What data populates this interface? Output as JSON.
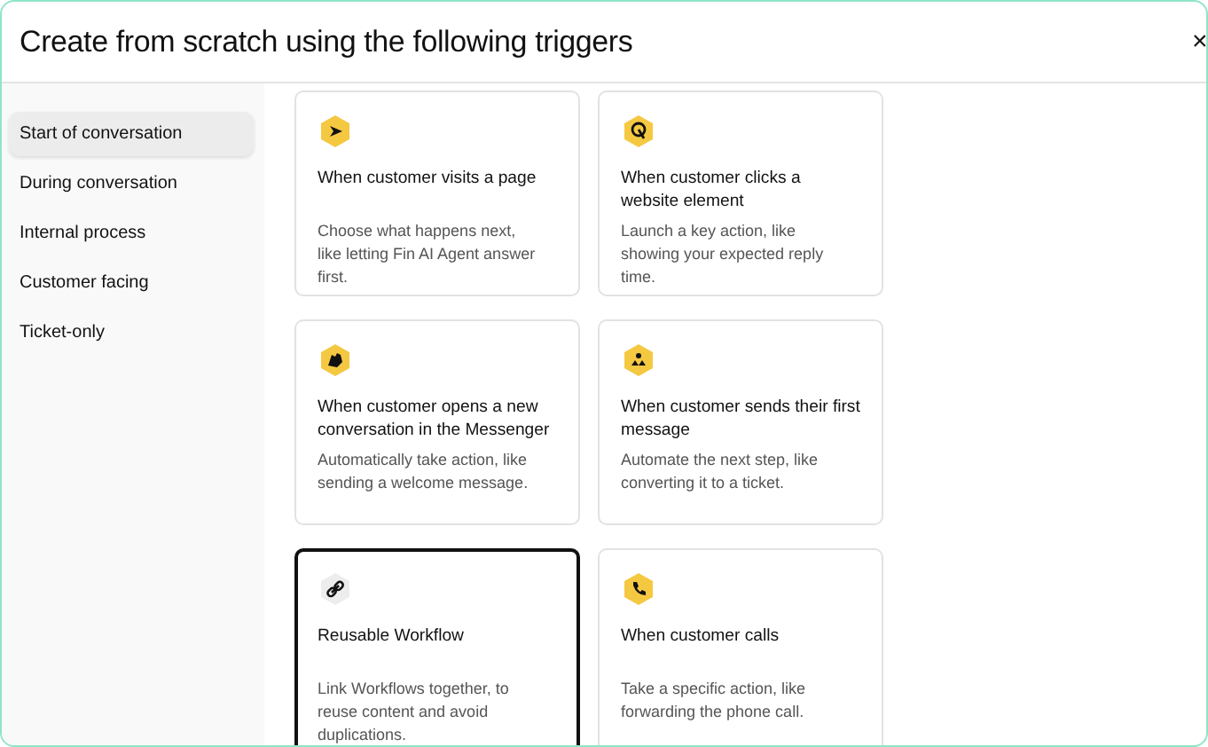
{
  "dialog": {
    "title": "Create from scratch using the following triggers",
    "close": "×"
  },
  "sidebar": {
    "items": [
      {
        "label": "Start of conversation",
        "selected": true
      },
      {
        "label": "During conversation",
        "selected": false
      },
      {
        "label": "Internal process",
        "selected": false
      },
      {
        "label": "Customer facing",
        "selected": false
      },
      {
        "label": "Ticket-only",
        "selected": false
      }
    ]
  },
  "cards": [
    {
      "kind": "visit",
      "title": "When customer visits a page",
      "description": "Choose what happens next, like letting Fin AI Agent answer first.",
      "selected": false
    },
    {
      "kind": "click",
      "title": "When customer clicks a website element",
      "description": "Launch a key action, like showing your expected reply time.",
      "selected": false
    },
    {
      "kind": "wave",
      "title": "When customer opens a new conversation in the Messenger",
      "description": "Automatically take action, like sending a welcome message.",
      "selected": false
    },
    {
      "kind": "message",
      "title": "When customer sends their first message",
      "description": "Automate the next step, like converting it to a ticket.",
      "selected": false
    },
    {
      "kind": "link",
      "title": "Reusable Workflow",
      "description": "Link Workflows together, to reuse content and avoid duplications.",
      "selected": true
    },
    {
      "kind": "call",
      "title": "When customer calls",
      "description": "Take a specific action, like forwarding the phone call.",
      "selected": false
    }
  ]
}
